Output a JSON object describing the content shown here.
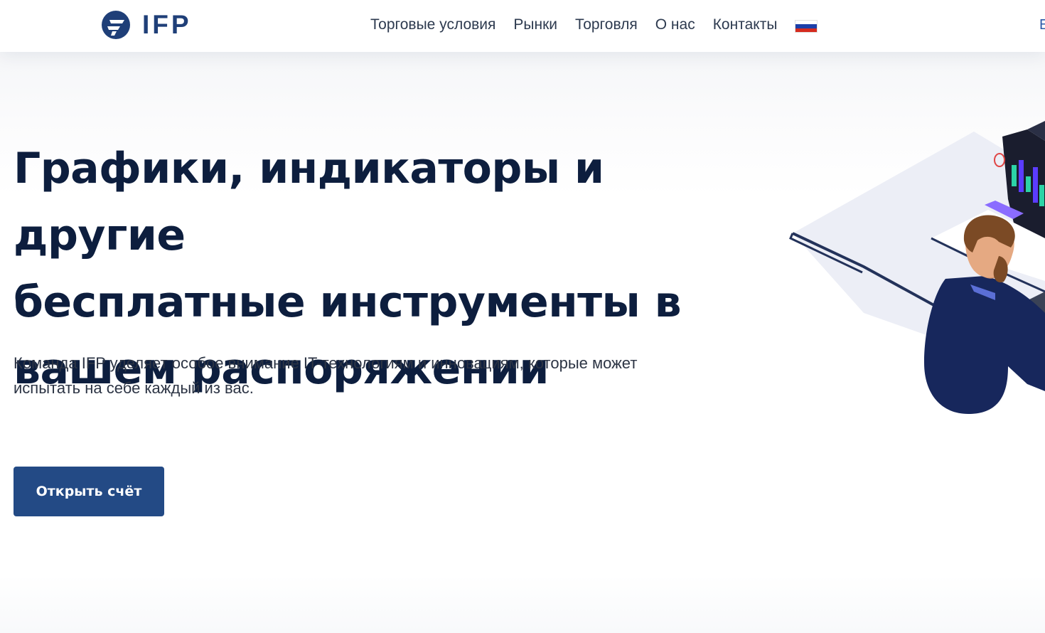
{
  "header": {
    "logo_text": "IFP",
    "nav": [
      {
        "label": "Торговые условия"
      },
      {
        "label": "Рынки"
      },
      {
        "label": "Торговля"
      },
      {
        "label": "О нас"
      },
      {
        "label": "Контакты"
      }
    ],
    "language_flag": "russia-flag",
    "edge_text": "E"
  },
  "hero": {
    "headline_lines": [
      "Графики, индикаторы и другие",
      "бесплатные инструменты в",
      "вашем распоряжении"
    ],
    "subtext_lines": [
      "Команда IFP уделяет особое внимание IT-технологиям и инновациям, которые может",
      "испытать на себе каждый из вас."
    ],
    "cta_label": "Открыть счёт"
  },
  "colors": {
    "brand_blue": "#1f3f78",
    "cta_bg": "#234a85",
    "headline": "#0d1e3e"
  }
}
